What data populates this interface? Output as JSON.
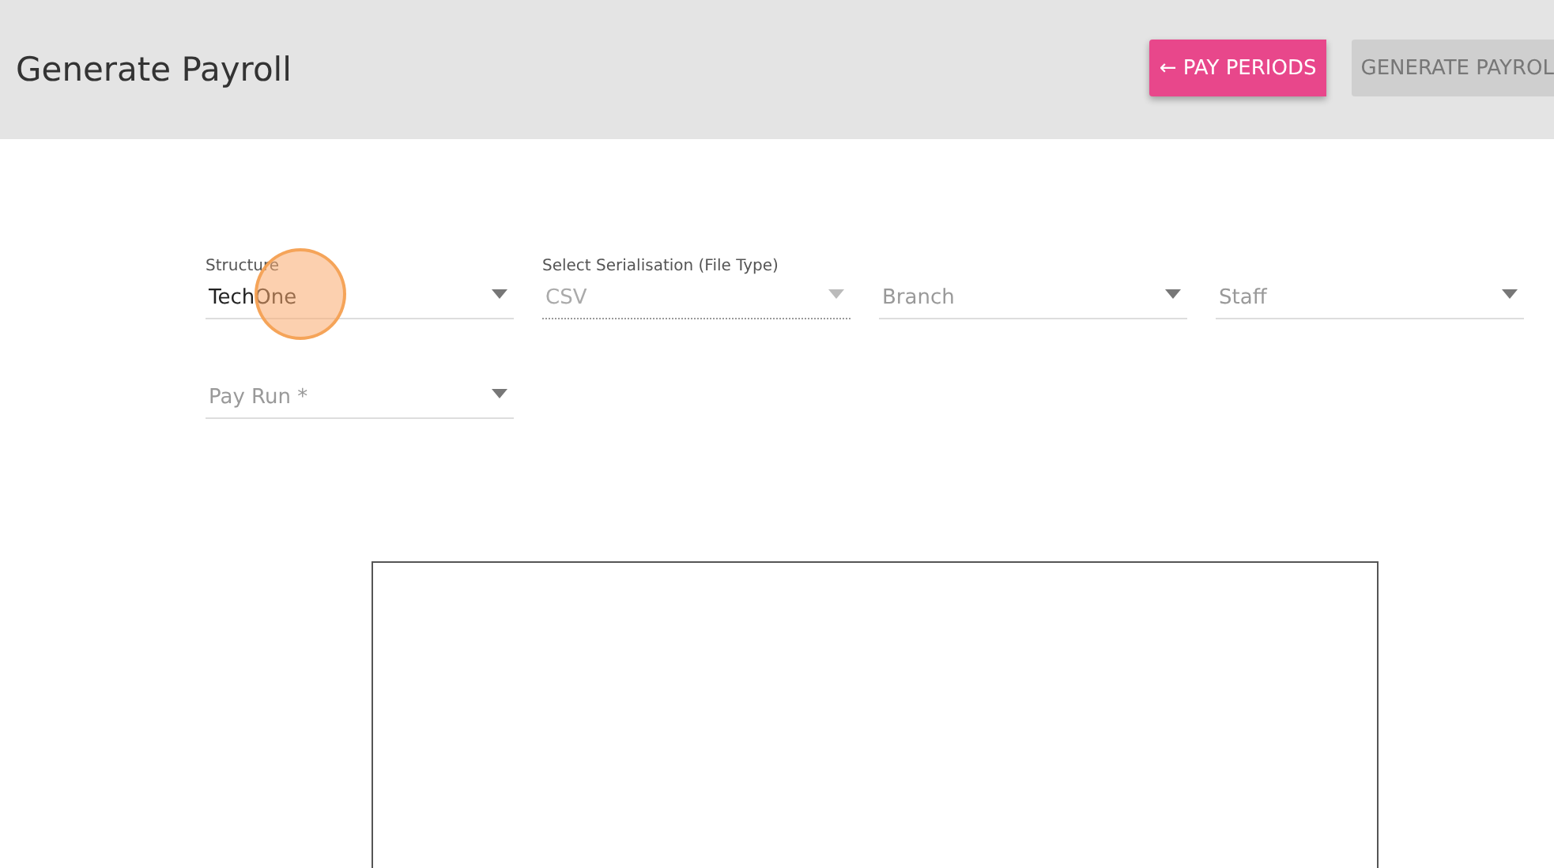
{
  "header": {
    "title": "Generate Payroll",
    "buttons": [
      {
        "label": "← PAY PERIODS",
        "disabled": false
      },
      {
        "label": "GENERATE PAYROL",
        "disabled": true
      }
    ]
  },
  "filters": [
    {
      "label": "Structure",
      "value": "TechOne",
      "disabled": false,
      "click_highlight": true
    },
    {
      "label": "Select Serialisation (File Type)",
      "value": "CSV",
      "disabled": true,
      "click_highlight": false
    },
    {
      "placeholder": "Branch",
      "disabled": false,
      "click_highlight": false
    },
    {
      "placeholder": "Staff",
      "disabled": false,
      "click_highlight": false
    },
    {
      "placeholder": "Pay Run *",
      "disabled": false,
      "click_highlight": false
    }
  ],
  "preview": {
    "kind": "blank_panel"
  }
}
